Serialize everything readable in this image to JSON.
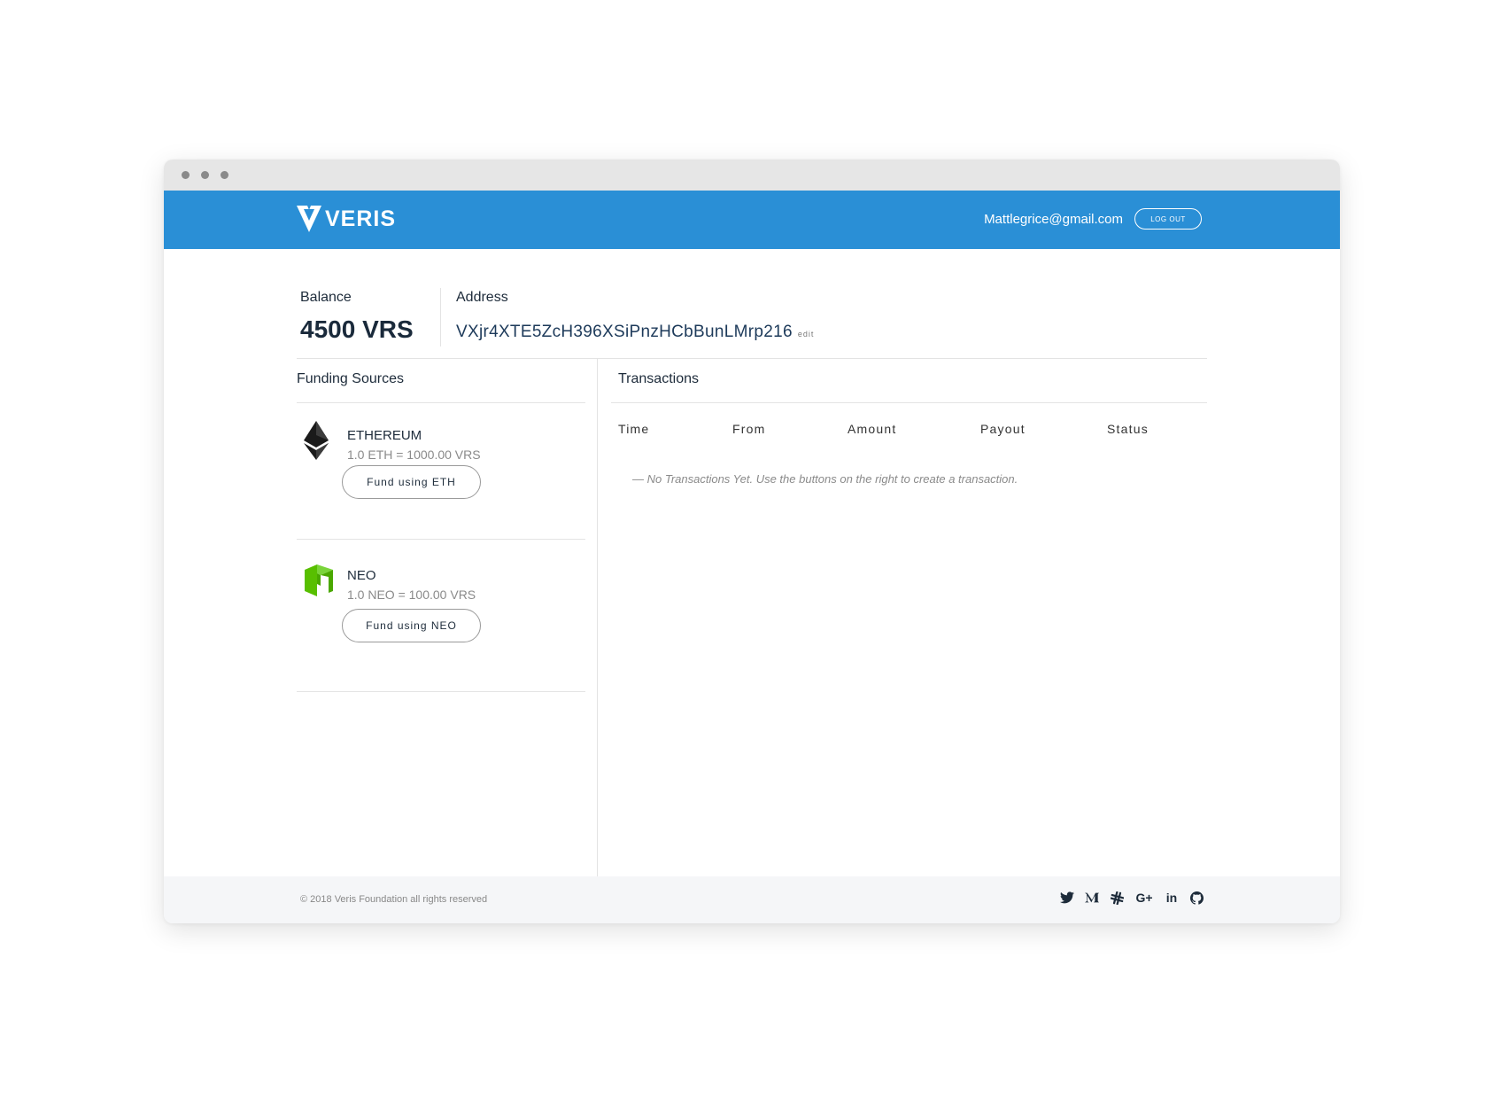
{
  "header": {
    "logo_text": "VERIS",
    "email": "Mattlegrice@gmail.com",
    "logout_label": "LOG OUT"
  },
  "account": {
    "balance_label": "Balance",
    "balance_value": "4500 VRS",
    "address_label": "Address",
    "address_value": "VXjr4XTE5ZcH396XSiPnzHCbBunLMrp216",
    "edit_label": "edit"
  },
  "funding": {
    "title": "Funding Sources",
    "sources": [
      {
        "name": "ETHEREUM",
        "rate": "1.0 ETH = 1000.00 VRS",
        "button": "Fund using ETH",
        "icon": "ethereum-icon",
        "color": "#1a1a1a"
      },
      {
        "name": "NEO",
        "rate": "1.0 NEO = 100.00 VRS",
        "button": "Fund using NEO",
        "icon": "neo-icon",
        "color": "#58bf00"
      }
    ]
  },
  "transactions": {
    "title": "Transactions",
    "columns": [
      "Time",
      "From",
      "Amount",
      "Payout",
      "Status"
    ],
    "empty_message": "— No Transactions Yet. Use the buttons on the right to create a transaction."
  },
  "footer": {
    "copyright": "© 2018 Veris Foundation all rights reserved",
    "socials": [
      "twitter-icon",
      "medium-icon",
      "slack-icon",
      "google-plus-icon",
      "linkedin-icon",
      "github-icon"
    ],
    "google_plus_text": "G+",
    "linkedin_text": "in"
  },
  "theme": {
    "brand_blue": "#2a8fd6",
    "footer_bg": "#f5f6f8"
  }
}
